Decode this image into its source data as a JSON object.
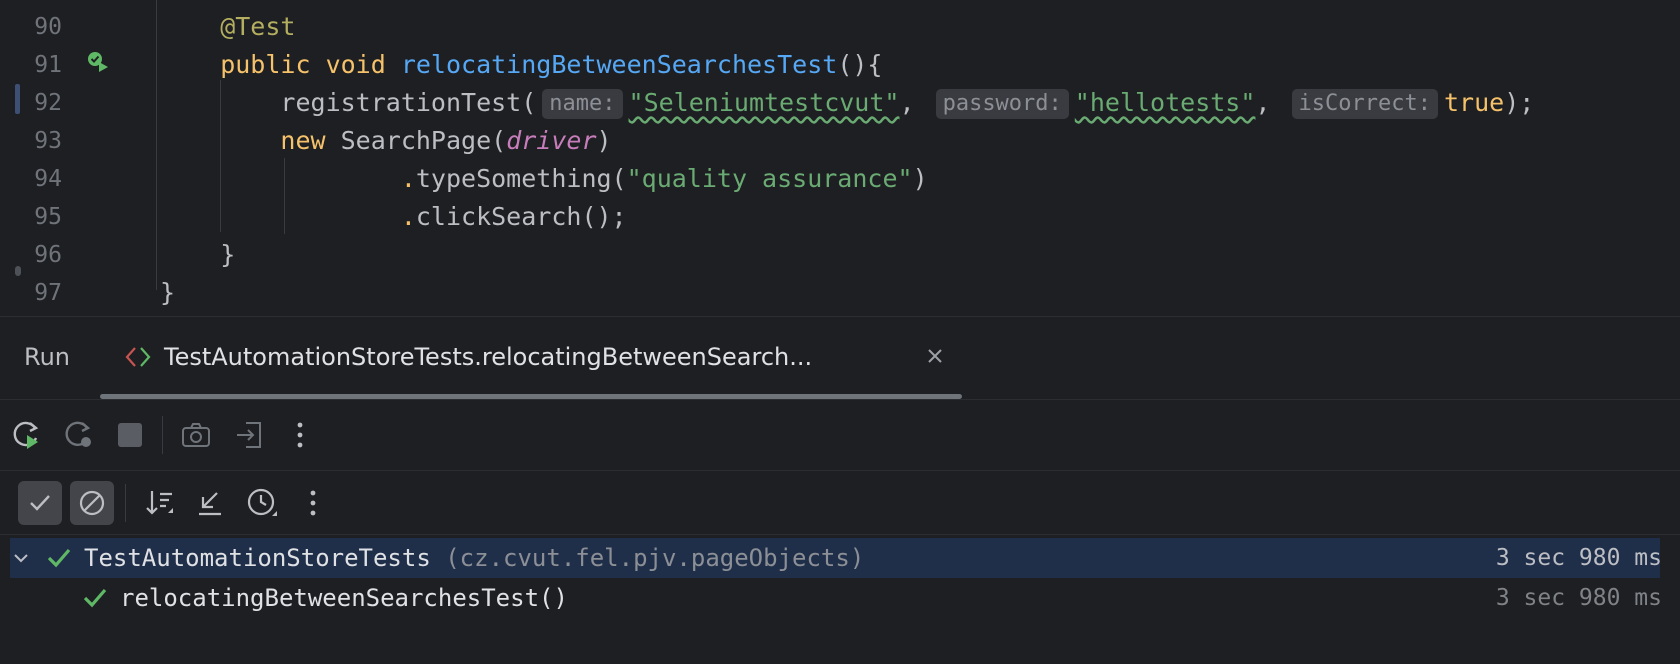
{
  "editor": {
    "lines": [
      {
        "num": "90",
        "parts": [
          {
            "t": "    @Test",
            "c": "ann"
          }
        ]
      },
      {
        "num": "91",
        "parts": [
          {
            "t": "    public void ",
            "c": "kw2"
          },
          {
            "t": "relocatingBetweenSearchesTest",
            "c": "fn"
          },
          {
            "t": "(){",
            "c": ""
          }
        ]
      },
      {
        "num": "92",
        "parts": [
          {
            "t": "        registrationTest(",
            "c": ""
          },
          {
            "hint": "name:"
          },
          {
            "t": "\"Seleniumtestcvut\"",
            "c": "str wavy"
          },
          {
            "t": ", ",
            "c": ""
          },
          {
            "hint": "password:"
          },
          {
            "t": "\"hellotests\"",
            "c": "str wavy"
          },
          {
            "t": ", ",
            "c": ""
          },
          {
            "hint": "isCorrect:"
          },
          {
            "t": "true",
            "c": "kw2"
          },
          {
            "t": ");",
            "c": ""
          }
        ]
      },
      {
        "num": "93",
        "parts": [
          {
            "t": "        new ",
            "c": "kw2"
          },
          {
            "t": "SearchPage(",
            "c": ""
          },
          {
            "t": "driver",
            "c": "param"
          },
          {
            "t": ")",
            "c": ""
          }
        ]
      },
      {
        "num": "94",
        "parts": [
          {
            "t": "                .",
            "c": "kw2"
          },
          {
            "t": "typeSomething(",
            "c": ""
          },
          {
            "t": "\"quality assurance\"",
            "c": "str"
          },
          {
            "t": ")",
            "c": ""
          }
        ]
      },
      {
        "num": "95",
        "parts": [
          {
            "t": "                .",
            "c": "kw2"
          },
          {
            "t": "clickSearch();",
            "c": ""
          }
        ]
      },
      {
        "num": "96",
        "parts": [
          {
            "t": "    }",
            "c": ""
          }
        ]
      },
      {
        "num": "97",
        "parts": [
          {
            "t": "}",
            "c": ""
          }
        ]
      }
    ]
  },
  "run_panel": {
    "label": "Run",
    "tab_title": "TestAutomationStoreTests.relocatingBetweenSearch...",
    "toolbar_icons": [
      "rerun-icon",
      "rerun-failed-icon",
      "stop-icon",
      "screenshot-icon",
      "export-icon",
      "more-icon"
    ],
    "filter_icons": [
      "show-passed-icon",
      "show-ignored-icon",
      "sort-icon",
      "collapse-icon",
      "history-icon",
      "more-icon"
    ]
  },
  "tree": [
    {
      "name": "TestAutomationStoreTests",
      "pkg": "(cz.cvut.fel.pjv.pageObjects)",
      "time": "3 sec 980 ms",
      "status": "passed",
      "expanded": true
    },
    {
      "name": "relocatingBetweenSearchesTest()",
      "pkg": "",
      "time": "3 sec 980 ms",
      "status": "passed"
    }
  ],
  "colors": {
    "passed": "#5fb865",
    "keyword": "#f5c26b",
    "string": "#6aab73",
    "function": "#56a8f5"
  }
}
